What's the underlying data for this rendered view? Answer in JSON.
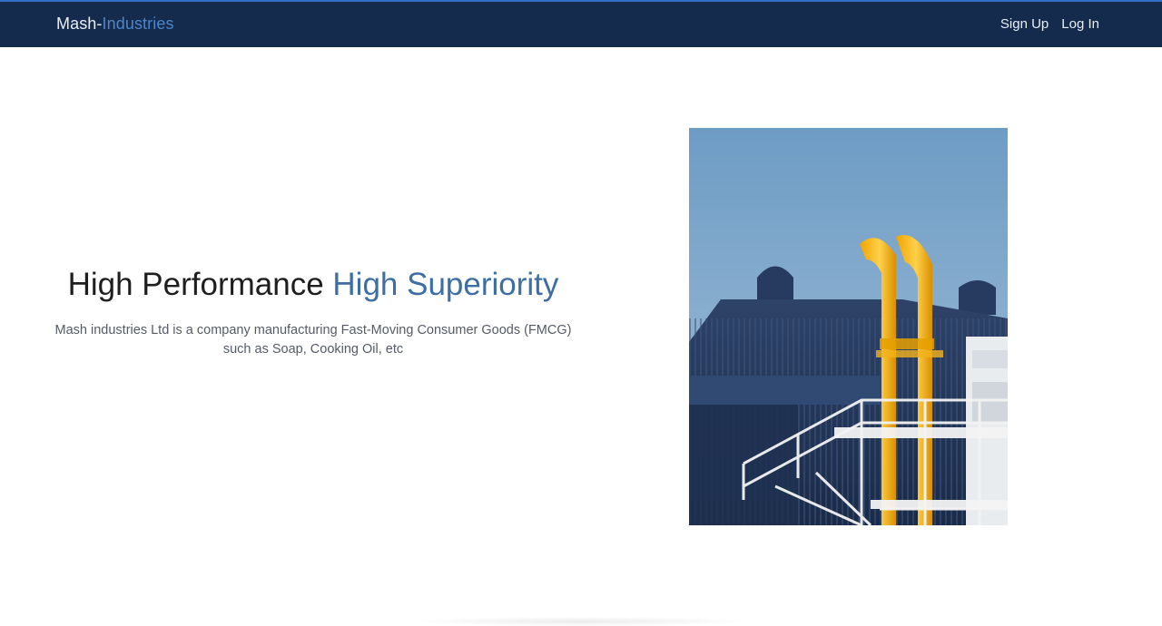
{
  "nav": {
    "brand_main": "Mash-",
    "brand_accent": "Industries",
    "links": [
      {
        "label": "Sign Up"
      },
      {
        "label": "Log In"
      }
    ]
  },
  "hero": {
    "title_main": "High Performance ",
    "title_accent": "High Superiority",
    "description": "Mash industries Ltd is a company manufacturing Fast-Moving Consumer Goods (FMCG) such as Soap, Cooking Oil, etc",
    "image": {
      "subject": "industrial-building-photo",
      "colors": {
        "sky": "#7fa7c9",
        "building": "#243756",
        "pipes": "#f2b31a",
        "structure": "#f2f2f2"
      }
    }
  },
  "colors": {
    "nav_bg": "#142b4d",
    "accent": "#3d6ea5",
    "text": "#1e1e1e"
  }
}
